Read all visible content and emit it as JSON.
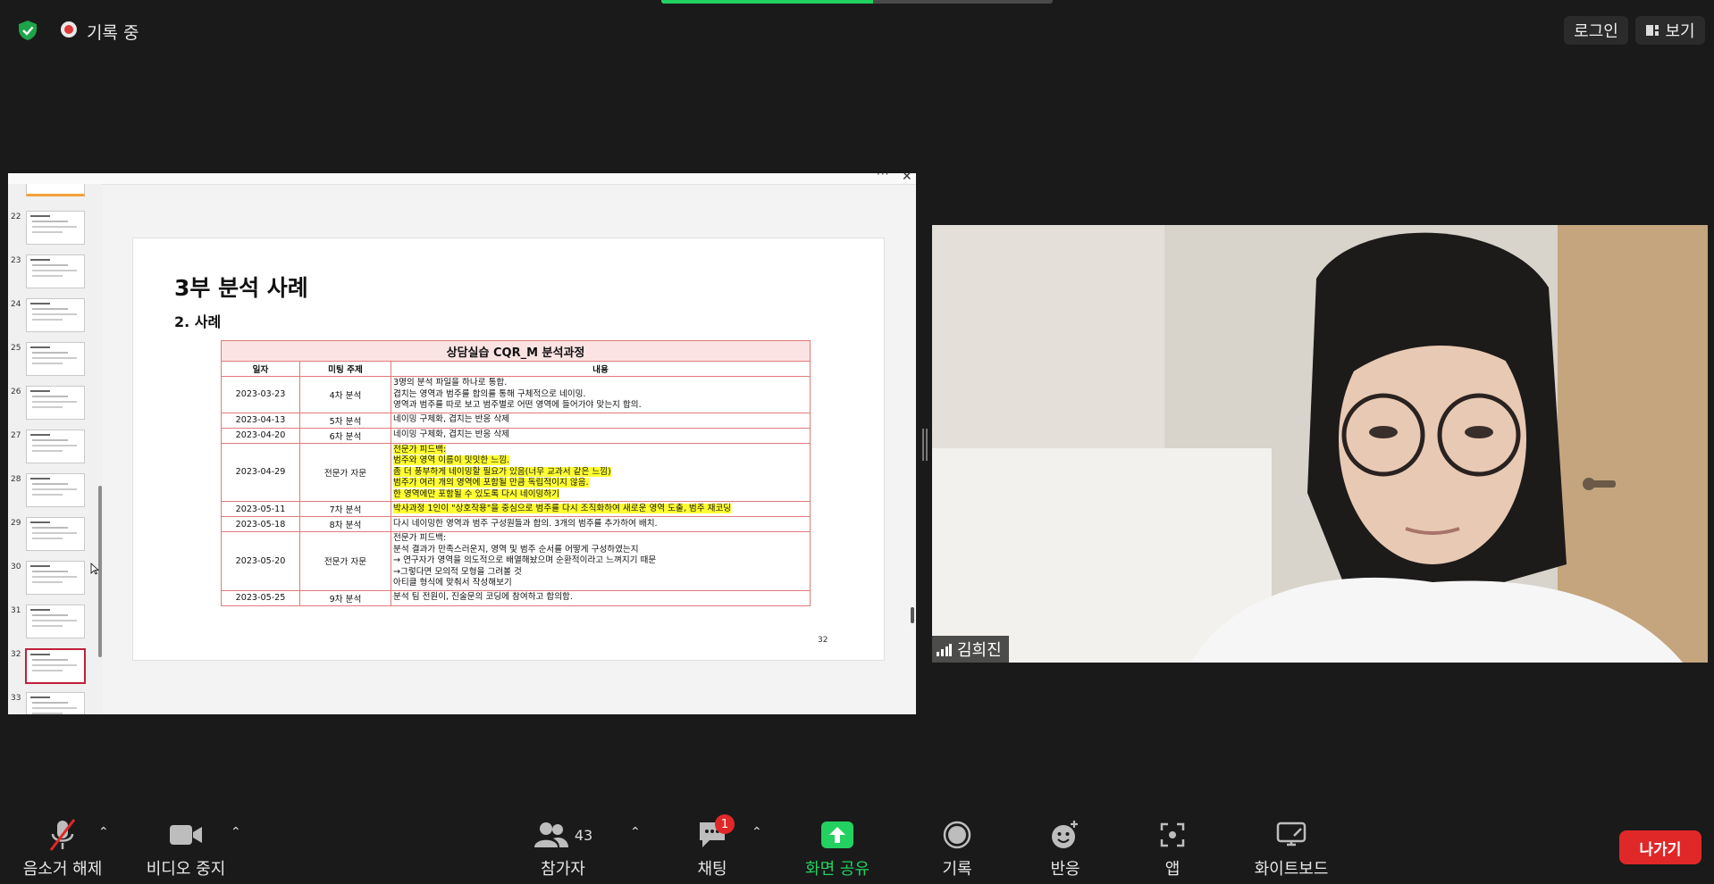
{
  "top": {
    "recording_label": "기록 중",
    "login_label": "로그인",
    "view_label": "보기",
    "progress_fraction": 0.54
  },
  "thumbnails": [
    {
      "num": "22"
    },
    {
      "num": "23"
    },
    {
      "num": "24"
    },
    {
      "num": "25"
    },
    {
      "num": "26"
    },
    {
      "num": "27"
    },
    {
      "num": "28"
    },
    {
      "num": "29"
    },
    {
      "num": "30"
    },
    {
      "num": "31"
    },
    {
      "num": "32",
      "active": true
    },
    {
      "num": "33"
    }
  ],
  "slide": {
    "title": "3부 분석 사례",
    "subtitle": "2. 사례",
    "page_number": "32",
    "table_title": "상담실습 CQR_M 분석과정",
    "headers": [
      "일자",
      "미팅 주제",
      "내용"
    ],
    "rows": [
      {
        "date": "2023-03-23",
        "topic": "4차 분석",
        "highlight": false,
        "lines": [
          "3명의 분석 파일을 하나로 통합.",
          "겹치는 영역과 범주를 합의를 통해 구체적으로 네이밍.",
          "영역과 범주를 따로 보고 범주별로 어떤 영역에 들어가야 맞는지 합의."
        ]
      },
      {
        "date": "2023-04-13",
        "topic": "5차 분석",
        "highlight": false,
        "lines": [
          "네이밍 구체화, 겹치는 반응 삭제"
        ]
      },
      {
        "date": "2023-04-20",
        "topic": "6차 분석",
        "highlight": false,
        "lines": [
          "네이밍 구체화, 겹치는 반응 삭제"
        ]
      },
      {
        "date": "2023-04-29",
        "topic": "전문가 자문",
        "highlight": true,
        "lines": [
          "전문가 피드백:",
          "범주와 영역 이름이 밋밋한 느낌.",
          "좀 더 풍부하게 네이밍할 필요가 있음(너무 교과서 같은 느낌)",
          "범주가 여러 개의 영역에 포함될 만큼 독립적이지 않음.",
          "한 영역에만 포함될 수 있도록 다시 네이밍하기"
        ]
      },
      {
        "date": "2023-05-11",
        "topic": "7차 분석",
        "highlight": true,
        "lines": [
          "박사과정 1인이 \"상호작용\"을 중심으로 범주를 다시 조직화하여 새로운 영역 도출, 범주 재코딩"
        ]
      },
      {
        "date": "2023-05-18",
        "topic": "8차 분석",
        "highlight": false,
        "lines": [
          "다시 네이밍한 영역과 범주 구성원들과 합의. 3개의 범주를 추가하여 배치."
        ]
      },
      {
        "date": "2023-05-20",
        "topic": "전문가 자문",
        "highlight": false,
        "lines": [
          "전문가 피드백:",
          "분석 결과가 만족스러운지, 영역 및 범주 순서를 어떻게 구성하였는지",
          "→ 연구자가 영역을 의도적으로 배열해놨으며 순환적이라고 느껴지기 때문",
          "→그렇다면 모의적 모형을 그려볼 것",
          "아티클 형식에 맞춰서 작성해보기"
        ]
      },
      {
        "date": "2023-05-25",
        "topic": "9차 분석",
        "highlight": false,
        "lines": [
          "분석 팀 전원이, 진술문의 코딩에 참여하고 합의함."
        ]
      }
    ]
  },
  "video": {
    "participant_name": "김희진"
  },
  "toolbar": {
    "mute_label": "음소거 해제",
    "video_label": "비디오 중지",
    "participants_label": "참가자",
    "participants_count": "43",
    "chat_label": "채팅",
    "chat_badge": "1",
    "share_label": "화면 공유",
    "record_label": "기록",
    "reactions_label": "반응",
    "apps_label": "앱",
    "whiteboard_label": "화이트보드",
    "leave_label": "나가기"
  },
  "colors": {
    "share_green": "#23d160",
    "leave_red": "#e02828",
    "highlight_yellow": "#ffff33",
    "table_border": "#e07a7a"
  }
}
